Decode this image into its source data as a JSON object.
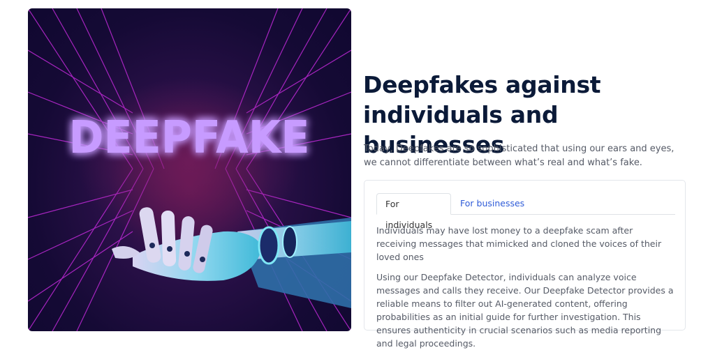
{
  "hero": {
    "image_text": "DEEPFAKE",
    "colors": {
      "background": "#1a0b3a",
      "grid": "#c02ad8",
      "text_glow": "#c79bff",
      "hand": "#6ee0f0"
    }
  },
  "headline": {
    "line1": "Deepfakes against",
    "line2": "individuals and businesses"
  },
  "intro": "Today, Deepfakes are so sophisticated that using our ears and eyes, we cannot differentiate between what’s real and what’s fake.",
  "tabs": [
    {
      "label": "For individuals",
      "active": true
    },
    {
      "label": "For businesses",
      "active": false
    }
  ],
  "panel": {
    "paragraph1": "Individuals may have lost money to a deepfake scam after receiving messages that mimicked and cloned the voices of their loved ones",
    "paragraph2": "Using our Deepfake Detector, individuals can analyze voice messages and calls they receive. Our Deepfake Detector provides a reliable means to filter out AI-generated content, offering probabilities as an initial guide for further investigation. This ensures authenticity in crucial scenarios such as media reporting and legal proceedings."
  },
  "colors": {
    "headline": "#0b1a38",
    "body_text": "#555a66",
    "link": "#2e5bd8"
  }
}
